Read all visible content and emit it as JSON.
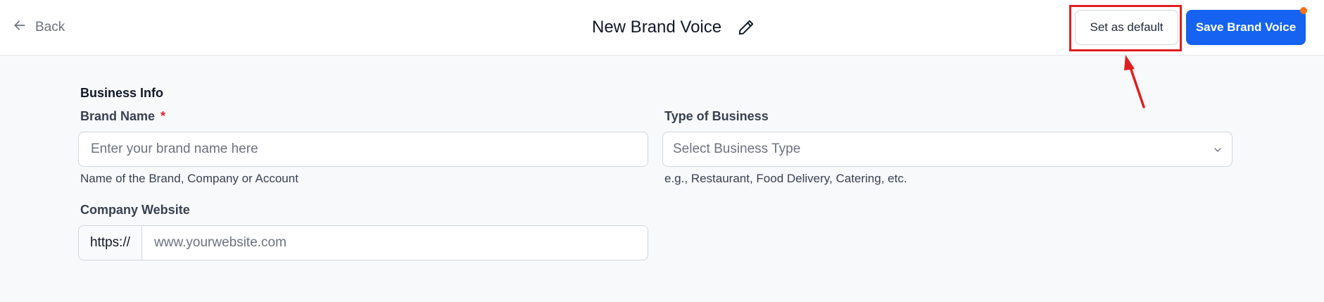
{
  "header": {
    "back_label": "Back",
    "title": "New Brand Voice",
    "set_default_label": "Set as default",
    "save_label": "Save Brand Voice"
  },
  "form": {
    "section_title": "Business Info",
    "brand_name": {
      "label": "Brand Name",
      "required_mark": "*",
      "placeholder": "Enter your brand name here",
      "hint": "Name of the Brand, Company or Account"
    },
    "business_type": {
      "label": "Type of Business",
      "placeholder": "Select Business Type",
      "hint": "e.g., Restaurant, Food Delivery, Catering, etc."
    },
    "website": {
      "label": "Company Website",
      "prefix": "https://",
      "placeholder": "www.yourwebsite.com"
    }
  },
  "colors": {
    "primary": "#1563f0",
    "highlight": "#e11d1d",
    "notification": "#f97316",
    "required": "#dc2626"
  },
  "icons": {
    "back": "arrow-left-icon",
    "edit": "pencil-icon",
    "dropdown": "chevron-down-icon",
    "annotation": "red-arrow-icon"
  }
}
